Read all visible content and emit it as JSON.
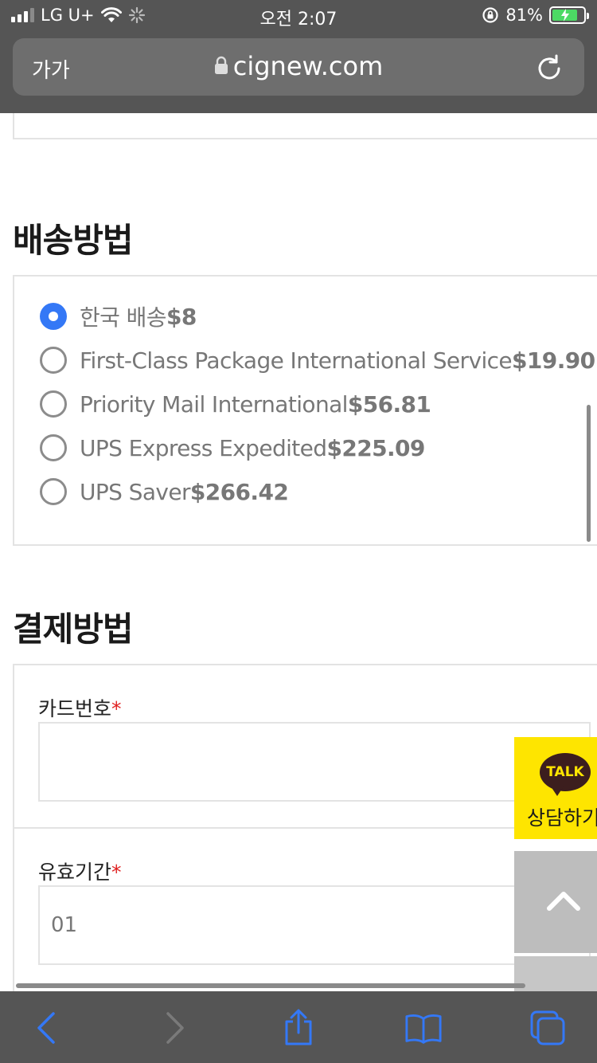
{
  "status_bar": {
    "carrier": "LG U+",
    "time": "오전 2:07",
    "battery_percent": "81%",
    "battery_level": 0.81
  },
  "browser": {
    "text_size_label": "가가",
    "url": "cignew.com"
  },
  "shipping": {
    "title": "배송방법",
    "selected_index": 0,
    "options": [
      {
        "name": "한국 배송",
        "price": "$8"
      },
      {
        "name": "First-Class Package International Service",
        "price": "$19.90"
      },
      {
        "name": "Priority Mail International",
        "price": "$56.81"
      },
      {
        "name": "UPS Express Expedited",
        "price": "$225.09"
      },
      {
        "name": "UPS Saver",
        "price": "$266.42"
      }
    ]
  },
  "payment": {
    "title": "결제방법",
    "card_number": {
      "label": "카드번호",
      "required_mark": "*",
      "value": ""
    },
    "expiry": {
      "label": "유효기간",
      "required_mark": "*",
      "value": "01"
    }
  },
  "floating": {
    "kakao_badge": "TALK",
    "kakao_label": "상담하기"
  },
  "colors": {
    "accent": "#3478f6",
    "required": "#e02020",
    "kakao": "#fee500",
    "browser_chrome": "#555555",
    "toolbar_icons": "#3478f6"
  }
}
